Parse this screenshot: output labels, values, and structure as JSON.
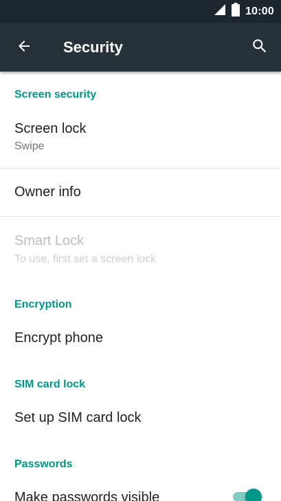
{
  "status_bar": {
    "time": "10:00",
    "icons": [
      "signal-icon",
      "battery-icon"
    ]
  },
  "toolbar": {
    "title": "Security",
    "back_icon": "arrow-left-icon",
    "search_icon": "search-icon"
  },
  "sections": [
    {
      "header": "Screen security",
      "items": [
        {
          "title": "Screen lock",
          "summary": "Swipe",
          "enabled": true
        },
        {
          "title": "Owner info",
          "summary": "",
          "enabled": true
        },
        {
          "title": "Smart Lock",
          "summary": "To use, first set a screen lock",
          "enabled": false
        }
      ]
    },
    {
      "header": "Encryption",
      "items": [
        {
          "title": "Encrypt phone",
          "enabled": true
        }
      ]
    },
    {
      "header": "SIM card lock",
      "items": [
        {
          "title": "Set up SIM card lock",
          "enabled": true
        }
      ]
    },
    {
      "header": "Passwords",
      "items": [
        {
          "title": "Make passwords visible",
          "toggle": true,
          "toggle_on": true
        }
      ]
    }
  ],
  "colors": {
    "accent": "#009688",
    "toolbar": "#273238",
    "status_bar": "#1c262c"
  }
}
